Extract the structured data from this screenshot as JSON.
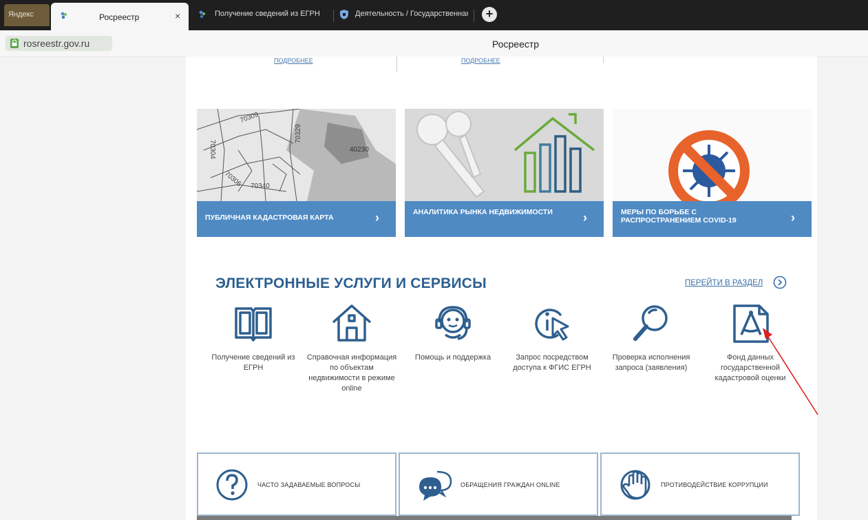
{
  "browser": {
    "tabs": [
      {
        "label": "Яндекс"
      },
      {
        "label": "Росреестр"
      },
      {
        "label": "Получение сведений из ЕГРН"
      },
      {
        "label": "Деятельность / Государственная"
      }
    ],
    "close_glyph": "×",
    "new_tab_glyph": "+",
    "url": "rosreestr.gov.ru",
    "page_title": "Росреестр"
  },
  "page": {
    "top_links": [
      "ПОДРОБНЕЕ",
      "ПОДРОБНЕЕ"
    ],
    "cards": [
      {
        "label": "ПУБЛИЧНАЯ КАДАСТРОВАЯ КАРТА",
        "map_labels": [
          "70309",
          "70304",
          "70329",
          "40230",
          "70340",
          "70306"
        ]
      },
      {
        "label": "АНАЛИТИКА РЫНКА НЕДВИЖИМОСТИ"
      },
      {
        "label": "МЕРЫ ПО БОРЬБЕ С РАСПРОСТРАНЕНИЕМ COVID-19"
      }
    ],
    "chevron": "›",
    "section_title": "ЭЛЕКТРОННЫЕ УСЛУГИ И СЕРВИСЫ",
    "section_link": "ПЕРЕЙТИ В РАЗДЕЛ",
    "services": [
      {
        "icon": "book-icon",
        "label": "Получение сведений из ЕГРН"
      },
      {
        "icon": "house-icon",
        "label": "Справочная информация по объектам недвижимости в режиме online"
      },
      {
        "icon": "support-headset-icon",
        "label": "Помощь и поддержка"
      },
      {
        "icon": "info-cursor-icon",
        "label": "Запрос посредством доступа к ФГИС ЕГРН"
      },
      {
        "icon": "magnifier-icon",
        "label": "Проверка исполнения запроса (заявления)"
      },
      {
        "icon": "compass-document-icon",
        "label": "Фонд данных государственной кадастровой оценки"
      }
    ],
    "info_boxes": [
      {
        "icon": "question-icon",
        "label": "ЧАСТО ЗАДАВАЕМЫЕ ВОПРОСЫ"
      },
      {
        "icon": "chat-icon",
        "label": "ОБРАЩЕНИЯ ГРАЖДАН ONLINE"
      },
      {
        "icon": "hand-stop-icon",
        "label": "ПРОТИВОДЕЙСТВИЕ КОРРУПЦИИ"
      }
    ]
  },
  "colors": {
    "accent_blue": "#4f8ac3",
    "title_blue": "#2d5f91",
    "annotation_red": "#e02020"
  }
}
